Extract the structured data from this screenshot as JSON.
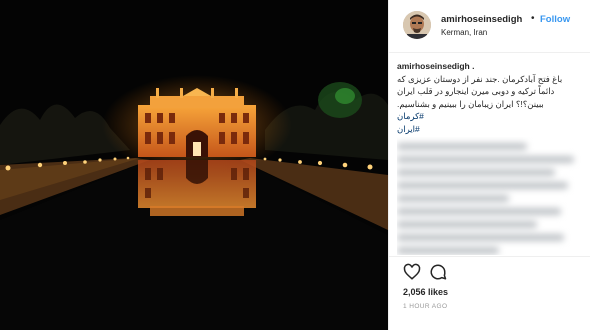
{
  "post": {
    "username": "amirhoseinsedigh",
    "dot": "•",
    "follow_label": "Follow",
    "location": "Kerman, Iran",
    "caption_user": "amirhoseinsedigh .",
    "caption_lines": [
      "باغ فتح آبادکرمان .جند نفر از دوستان عزیزی که",
      "دائماً ترکیه و دوبی میرن اینجارو در قلب ایران",
      "ببینن؟!؟ ایران زیبامان را ببینیم و بشناسیم."
    ],
    "hashtags": [
      "#کرمان",
      "#ایران"
    ],
    "likes": "2,056 likes",
    "time": "1 HOUR AGO"
  },
  "icons": {
    "avatar": "avatar-photo",
    "like": "heart-outline-icon",
    "comment": "comment-bubble-icon"
  },
  "colors": {
    "follow": "#3897f0",
    "hashtag": "#003569",
    "palace_light": "#f0962a"
  }
}
